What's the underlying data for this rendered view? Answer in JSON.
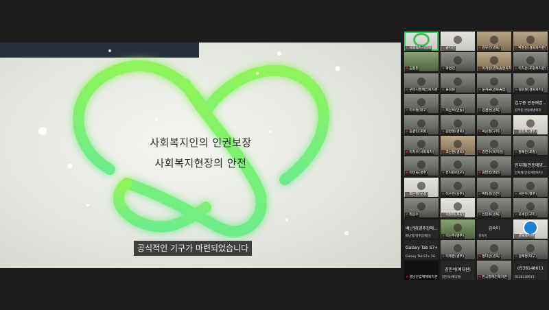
{
  "slide": {
    "line1": "사회복지인의 인권보장",
    "line2": "사회복지현장의 안전",
    "caption": "공식적인 기구가 마련되었습니다"
  },
  "colors": {
    "logo_green": "#7ff250",
    "logo_glow": "#a6ff6e",
    "active_speaker": "#2ed36b",
    "muted_mic": "#ff4a4a"
  },
  "gallery": {
    "tiles": [
      {
        "name": "사회복지사협회",
        "style": "t-white",
        "active": true,
        "icon": "wreath"
      },
      {
        "name": "송지선",
        "style": "t-white",
        "face": true
      },
      {
        "name": "김유선(경북)",
        "style": "t-warm",
        "face": true
      },
      {
        "name": "박정원(경북복지관)",
        "style": "t-warm",
        "face": true
      },
      {
        "name": "김정환",
        "style": "t-green"
      },
      {
        "name": "박현빈",
        "style": "t-cam",
        "face": true
      },
      {
        "name": "이지원(경북종합복지)",
        "style": "t-warm",
        "face": true
      },
      {
        "name": "이지은(포항복지관)",
        "style": "t-cam",
        "face": true
      },
      {
        "name": "구미시장애인복지관",
        "style": "t-cam",
        "face": true
      },
      {
        "name": "윤성원",
        "style": "t-cam",
        "face": true
      },
      {
        "name": "문지윤(경북종합)",
        "style": "t-cam",
        "face": true
      },
      {
        "name": "김민정(경북복지)",
        "style": "t-cam",
        "face": true
      },
      {
        "name": "이수정(대구)",
        "style": "t-cam",
        "face": true
      },
      {
        "name": "최은비(안동)",
        "style": "t-cam",
        "face": true
      },
      {
        "name": "김정현(경북)",
        "style": "t-cam",
        "face": true
      },
      {
        "name": "김무중 안동애명...",
        "style": "t-dark",
        "big": "김무중 안동애명...",
        "sub": "김무중 안동애명복지"
      },
      {
        "name": "김경민(포항)",
        "style": "t-cam",
        "face": true
      },
      {
        "name": "김현정(경북)",
        "style": "t-cam",
        "face": true
      },
      {
        "name": "박은영(구미)",
        "style": "t-cam",
        "face": true
      },
      {
        "name": "김성호(경주)",
        "style": "t-white",
        "face": true
      },
      {
        "name": "이지우(사회복지)",
        "style": "t-cam",
        "face": true
      },
      {
        "name": "조은정(경북)",
        "style": "t-warm",
        "face": true
      },
      {
        "name": "강민수(복지관)",
        "style": "t-cam",
        "face": true
      },
      {
        "name": "정혜진(포항)",
        "style": "t-cam",
        "face": true
      },
      {
        "name": "이미숙(경주)",
        "style": "t-cam",
        "face": true
      },
      {
        "name": "한지민(대구)",
        "style": "t-cam",
        "face": true
      },
      {
        "name": "김태형(영천)",
        "style": "t-cam",
        "face": true
      },
      {
        "name": "인지혜(안동애명)",
        "style": "t-dark",
        "big": "인지혜(안동애명...",
        "sub": "인지혜(안동애명복지)"
      },
      {
        "name": "최은영(문경)",
        "style": "t-white",
        "face": true
      },
      {
        "name": "이수민(상주)",
        "style": "t-cam",
        "face": true
      },
      {
        "name": "박미경(김천)",
        "style": "t-cam",
        "face": true
      },
      {
        "name": "서현아(영주)",
        "style": "t-cam",
        "face": true
      },
      {
        "name": "최은수",
        "style": "t-cam",
        "face": true
      },
      {
        "name": "이정미(포항)",
        "style": "t-white",
        "face": true
      },
      {
        "name": "신민호(경북)",
        "style": "t-cam",
        "face": true
      },
      {
        "name": "오세진(구미)",
        "style": "t-cam",
        "face": true
      },
      {
        "name": "배난영(영주장애...",
        "style": "t-dark",
        "big": "배난영(영주장애...",
        "sub": "배난영(영주장애인)"
      },
      {
        "name": "이은주(영주)",
        "style": "t-green",
        "face": true
      },
      {
        "name": "김숙이",
        "style": "t-dark",
        "big": "김숙이",
        "sub": "김숙이"
      },
      {
        "name": "경북복지관",
        "style": "t-white",
        "icon": "badge"
      },
      {
        "name": "Galaxy Tab S7+",
        "style": "t-dark",
        "big": "Galaxy Tab S7+...",
        "sub": "Galaxy Tab S7+ 5G"
      },
      {
        "name": "이재훈(경주)",
        "style": "t-cam",
        "face": true
      },
      {
        "name": "정다은(경북)",
        "style": "t-cam",
        "face": true
      },
      {
        "name": "김혜정(대구)",
        "style": "t-cam",
        "face": true
      },
      {
        "name": "경남산업재해복지관",
        "style": "t-black"
      },
      {
        "name": "김민석(예다원)",
        "style": "t-dark",
        "big": "김민석(예다원)",
        "sub": "김민석(예다원)"
      },
      {
        "name": "한국장애인복지관",
        "style": "t-cam",
        "face": true
      },
      {
        "name": "0538148611",
        "style": "t-dark",
        "big": "0538148611",
        "sub": "0538148611"
      }
    ]
  }
}
